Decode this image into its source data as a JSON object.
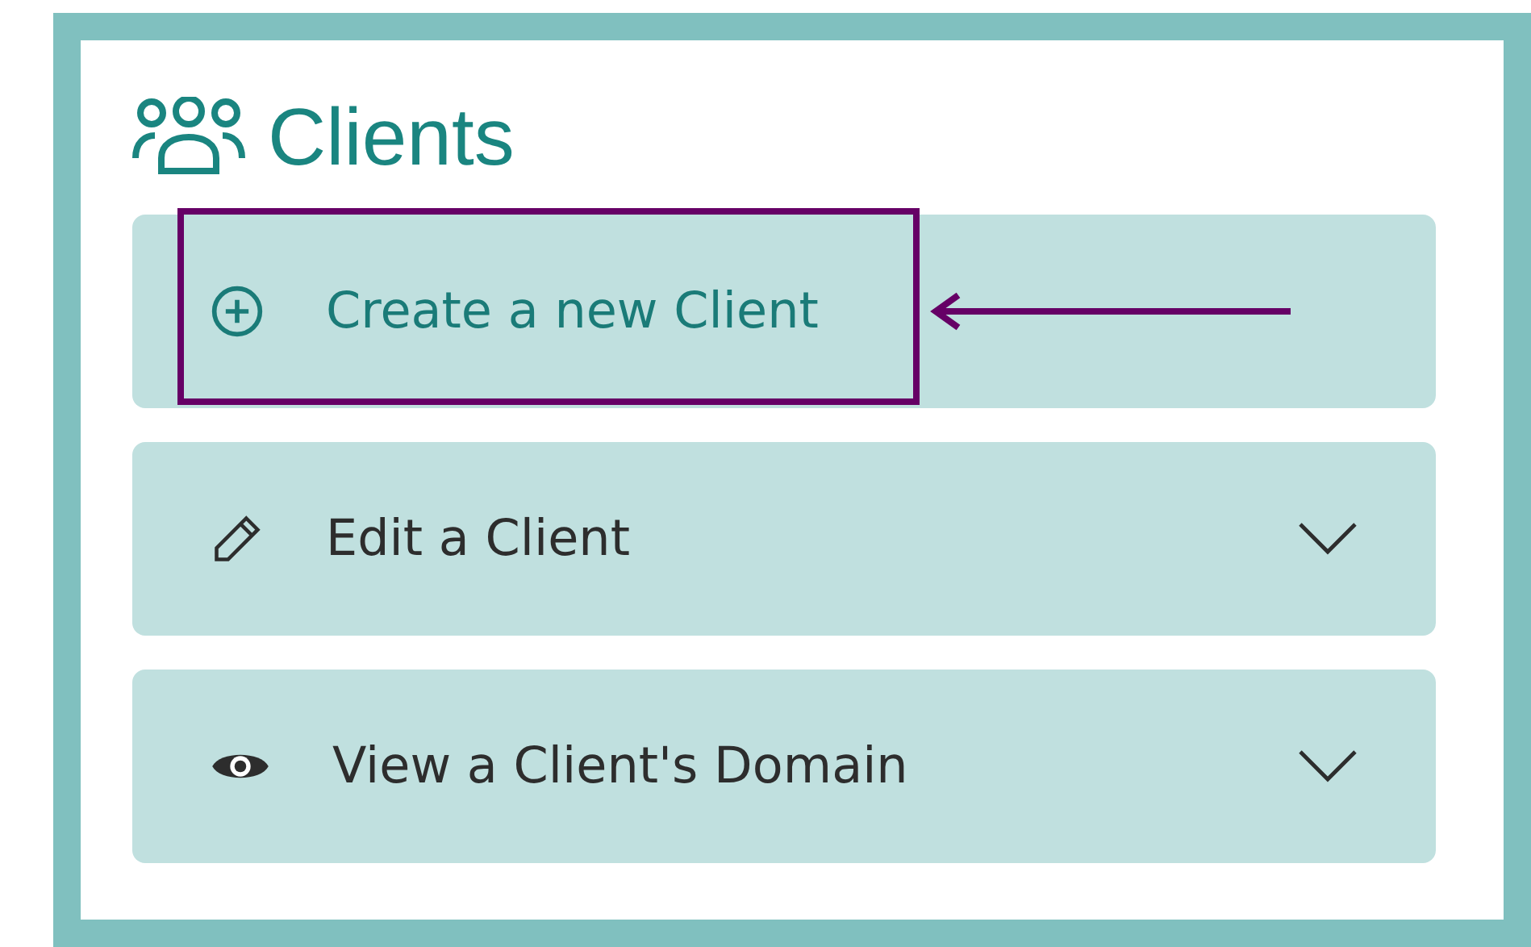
{
  "title": "Clients",
  "items": [
    {
      "label": "Create a new Client",
      "kind": "link",
      "highlighted": true
    },
    {
      "label": "Edit a Client",
      "kind": "dropdown",
      "expanded": false,
      "highlighted": false
    },
    {
      "label": "View a Client's Domain",
      "kind": "dropdown",
      "expanded": false,
      "highlighted": false
    }
  ]
}
